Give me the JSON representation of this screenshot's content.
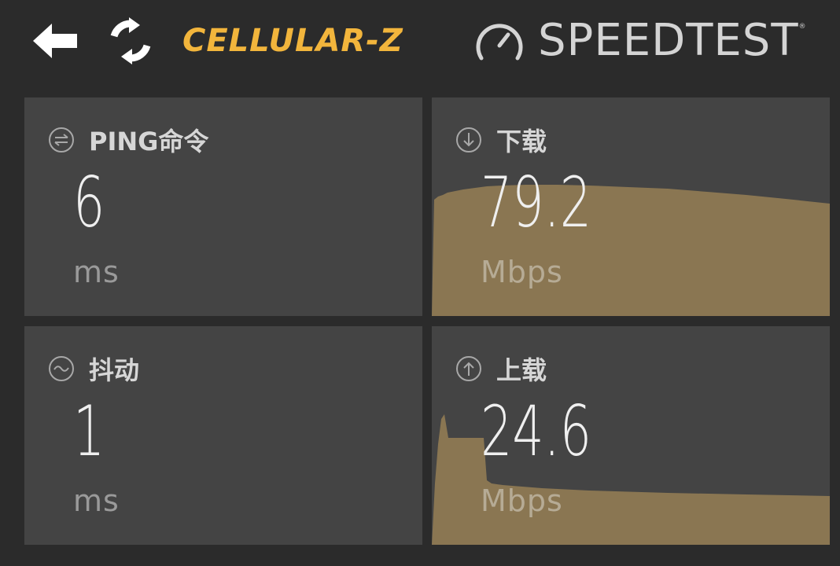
{
  "header": {
    "back_icon": "arrow-left-icon",
    "refresh_icon": "refresh-icon",
    "brand": "CELLULAR-Z",
    "gauge_icon": "speedometer-icon",
    "speedtest_label": "SPEEDTEST",
    "speedtest_mark": "®"
  },
  "colors": {
    "background": "#2b2b2b",
    "card": "#444444",
    "brand": "#f2b53c",
    "graph_fill": "#8a7652",
    "text_primary": "#efefef",
    "text_secondary": "#9a9a9a"
  },
  "cards": {
    "ping": {
      "icon": "ping-icon",
      "title": "PING命令",
      "value": "6",
      "unit": "ms"
    },
    "download": {
      "icon": "download-icon",
      "title": "下载",
      "value": "79.2",
      "unit": "Mbps"
    },
    "jitter": {
      "icon": "jitter-icon",
      "title": "抖动",
      "value": "1",
      "unit": "ms"
    },
    "upload": {
      "icon": "upload-icon",
      "title": "上载",
      "value": "24.6",
      "unit": "Mbps"
    }
  }
}
